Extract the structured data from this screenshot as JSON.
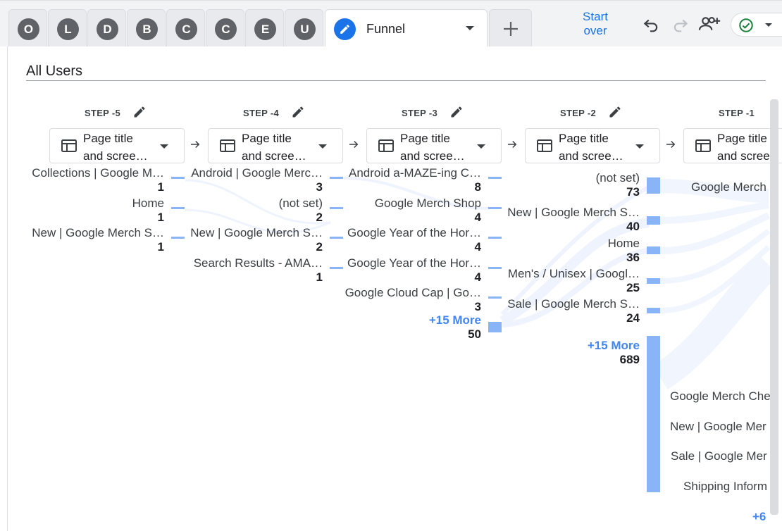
{
  "tabs": {
    "letters": [
      "O",
      "L",
      "D",
      "B",
      "C",
      "C",
      "E",
      "U"
    ],
    "active": {
      "name": "Funnel",
      "icon": "pencil-icon"
    },
    "add_icon": "plus-icon"
  },
  "toolbar": {
    "start_over_line1": "Start",
    "start_over_line2": "over",
    "undo_icon": "undo-icon",
    "redo_icon": "redo-icon",
    "share_icon": "add-person-icon",
    "status_icon": "check-circle-icon"
  },
  "segment": {
    "title": "All Users"
  },
  "steps": [
    {
      "label": "STEP -5",
      "dimension": "Page title\nand scree…"
    },
    {
      "label": "STEP -4",
      "dimension": "Page title\nand scree…"
    },
    {
      "label": "STEP -3",
      "dimension": "Page title\nand scree…"
    },
    {
      "label": "STEP -2",
      "dimension": "Page title\nand scree…"
    },
    {
      "label": "STEP -1",
      "dimension": "Page title\nand scree"
    }
  ],
  "columns": [
    {
      "nodes": [
        {
          "name": "Collections | Google M…",
          "value": "1"
        },
        {
          "name": "Home",
          "value": "1"
        },
        {
          "name": "New | Google Merch S…",
          "value": "1"
        }
      ]
    },
    {
      "nodes": [
        {
          "name": "Android | Google Merc…",
          "value": "3"
        },
        {
          "name": "(not set)",
          "value": "2"
        },
        {
          "name": "New | Google Merch S…",
          "value": "2"
        },
        {
          "name": "Search Results - AMA…",
          "value": "1"
        }
      ]
    },
    {
      "nodes": [
        {
          "name": "Android a-MAZE-ing C…",
          "value": "8"
        },
        {
          "name": "Google Merch Shop",
          "value": "4"
        },
        {
          "name": "Google Year of the Hor…",
          "value": "4"
        },
        {
          "name": "Google Year of the Hor…",
          "value": "4"
        },
        {
          "name": "Google Cloud Cap | Go…",
          "value": "3"
        }
      ],
      "more": {
        "label": "+15 More",
        "value": "50"
      }
    },
    {
      "nodes": [
        {
          "name": "(not set)",
          "value": "73"
        },
        {
          "name": "New | Google Merch S…",
          "value": "40"
        },
        {
          "name": "Home",
          "value": "36"
        },
        {
          "name": "Men's / Unisex | Googl…",
          "value": "25"
        },
        {
          "name": "Sale | Google Merch S…",
          "value": "24"
        }
      ],
      "more": {
        "label": "+15 More",
        "value": "689"
      }
    }
  ],
  "step_minus1_names": [
    "Google Merch",
    "Google Merch Che",
    "New | Google Mer",
    "Sale | Google Mer",
    "Shipping Inform"
  ],
  "step_minus1_more": "+6",
  "colors": {
    "accent": "#1a73e8",
    "bar": "#8ab4f8",
    "flow": "#e8f0fe",
    "more": "#4285f4"
  }
}
